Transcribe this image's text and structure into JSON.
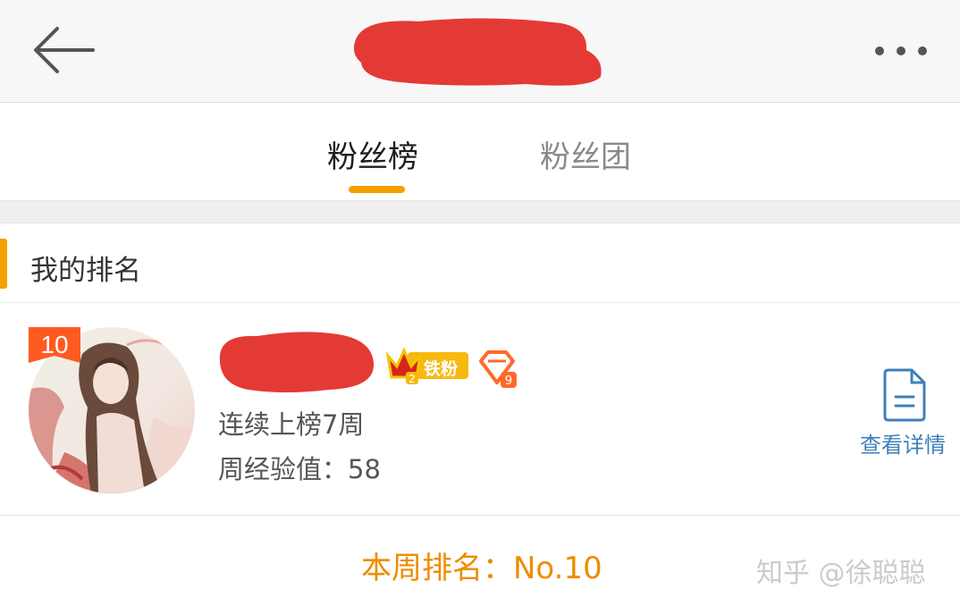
{
  "colors": {
    "accent": "#f4a000",
    "rank_text": "#ee8c00",
    "badge_red": "#ff5a1f",
    "link_blue": "#3f7fb9",
    "redaction": "#e43a36"
  },
  "header": {
    "back_icon": "arrow-left-icon",
    "more_icon": "more-dots-icon"
  },
  "tabs": [
    {
      "label": "粉丝榜",
      "active": true
    },
    {
      "label": "粉丝团",
      "active": false
    }
  ],
  "section": {
    "title": "我的排名"
  },
  "card": {
    "rank_badge": "10",
    "badge_iron_fan": "铁粉",
    "crown_level": "2",
    "diamond_level": "9",
    "streak": "连续上榜7周",
    "weekly_exp": "周经验值：58",
    "detail_label": "查看详情"
  },
  "footer": {
    "week_rank": "本周排名：No.10",
    "watermark": "知乎 @徐聪聪"
  }
}
